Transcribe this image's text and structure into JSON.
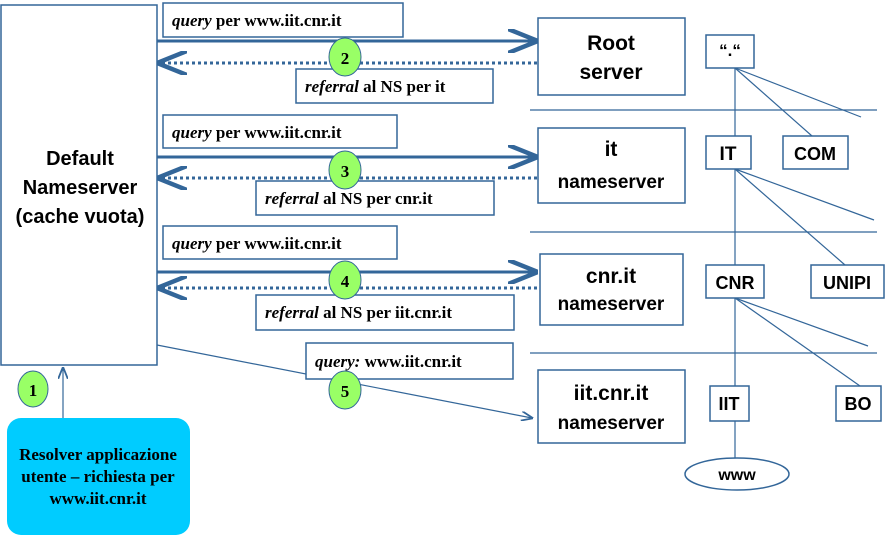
{
  "colors": {
    "line": "#336699",
    "step_circle": "#99ff66",
    "resolver": "#00ccff"
  },
  "default_ns": {
    "lines": [
      "Default",
      "Nameserver",
      "(cache vuota)"
    ]
  },
  "resolver": {
    "lines": [
      "Resolver applicazione",
      "utente – richiesta per",
      "www.iit.cnr.it"
    ]
  },
  "steps": [
    "1",
    "2",
    "3",
    "4",
    "5"
  ],
  "queries": [
    {
      "em": "query",
      "rest": " per www.iit.cnr.it"
    },
    {
      "em": "query",
      "rest": " per www.iit.cnr.it"
    },
    {
      "em": "query",
      "rest": " per www.iit.cnr.it"
    },
    {
      "em": "query:",
      "rest": " www.iit.cnr.it"
    }
  ],
  "referrals": [
    {
      "em": "referral",
      "rest": " al NS per it"
    },
    {
      "em": "referral",
      "rest": " al NS per cnr.it"
    },
    {
      "em": "referral",
      "rest": " al NS per iit.cnr.it"
    }
  ],
  "servers": [
    {
      "l1": "Root",
      "l2": "server"
    },
    {
      "l1": "it",
      "l2": "nameserver"
    },
    {
      "l1": "cnr.it",
      "l2": "nameserver"
    },
    {
      "l1": "iit.cnr.it",
      "l2": "nameserver"
    }
  ],
  "tree": {
    "root": "“.“",
    "it": "IT",
    "com": "COM",
    "cnr": "CNR",
    "unipi": "UNIPI",
    "iit": "IIT",
    "bo": "BO",
    "www": "www"
  }
}
